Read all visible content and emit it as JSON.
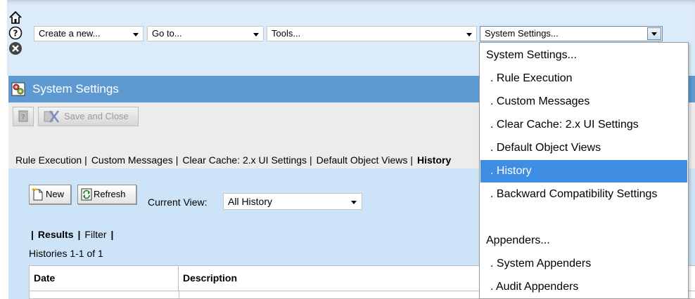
{
  "toolbar": {
    "create_select": "Create a new...",
    "goto_select": "Go to...",
    "tools_select": "Tools...",
    "system_select": "System Settings..."
  },
  "side_icons": [
    "home-icon",
    "help-icon",
    "close-icon"
  ],
  "header": {
    "title": "System Settings"
  },
  "actions": {
    "save_close": "Save and Close"
  },
  "tabs": [
    {
      "label": "Rule Execution",
      "active": false
    },
    {
      "label": "Custom Messages",
      "active": false
    },
    {
      "label": "Clear Cache: 2.x UI Settings",
      "active": false
    },
    {
      "label": "Default Object Views",
      "active": false
    },
    {
      "label": "History",
      "active": true
    }
  ],
  "history": {
    "new_label": "New",
    "refresh_label": "Refresh",
    "current_view_label": "Current View:",
    "current_view_value": "All History",
    "results_label": "Results",
    "filter_label": "Filter",
    "count_text": "Histories 1-1 of 1",
    "columns": [
      "Date",
      "Description"
    ]
  },
  "dropdown": {
    "items": [
      {
        "label": "System Settings...",
        "group": true
      },
      {
        "label": ". Rule Execution"
      },
      {
        "label": ". Custom Messages"
      },
      {
        "label": ". Clear Cache: 2.x UI Settings"
      },
      {
        "label": ". Default Object Views"
      },
      {
        "label": ". History",
        "selected": true
      },
      {
        "label": ". Backward Compatibility Settings"
      },
      {
        "label": ""
      },
      {
        "label": "Appenders...",
        "group": true
      },
      {
        "label": ". System Appenders"
      },
      {
        "label": ". Audit Appenders"
      }
    ]
  },
  "colors": {
    "title_bar": "#5e99d2",
    "toolbar_band": "#dcebf9",
    "content_bg": "#cde3f8",
    "selection": "#3f8ee4"
  }
}
